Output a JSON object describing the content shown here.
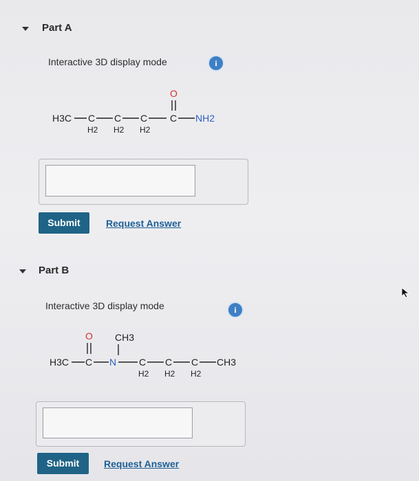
{
  "part_a": {
    "title": "Part A",
    "display_mode_label": "Interactive 3D display mode",
    "info_icon": "i",
    "molecule": {
      "left_group": "H3C",
      "chain": [
        "C",
        "C",
        "C",
        "C"
      ],
      "h2_label": "H2",
      "oxygen": "O",
      "right_group": "NH2"
    },
    "answer_value": "",
    "submit_label": "Submit",
    "request_label": "Request Answer"
  },
  "part_b": {
    "title": "Part B",
    "display_mode_label": "Interactive 3D display mode",
    "info_icon": "i",
    "molecule": {
      "left_group": "H3C",
      "carbonyl_carbon": "C",
      "oxygen": "O",
      "nitrogen": "N",
      "methyl": "CH3",
      "chain": [
        "C",
        "C",
        "C"
      ],
      "h2_label": "H2",
      "right_group": "CH3"
    },
    "answer_value": "",
    "submit_label": "Submit",
    "request_label": "Request Answer"
  },
  "icons": {
    "collapse": "caret-down-icon",
    "info": "info-icon",
    "cursor": "mouse-pointer-icon"
  },
  "colors": {
    "submit_bg": "#1f6386",
    "link": "#1d5f95",
    "info": "#3f7fc4",
    "oxygen": "#d0302f",
    "nitrogen": "#2f5fc0"
  }
}
